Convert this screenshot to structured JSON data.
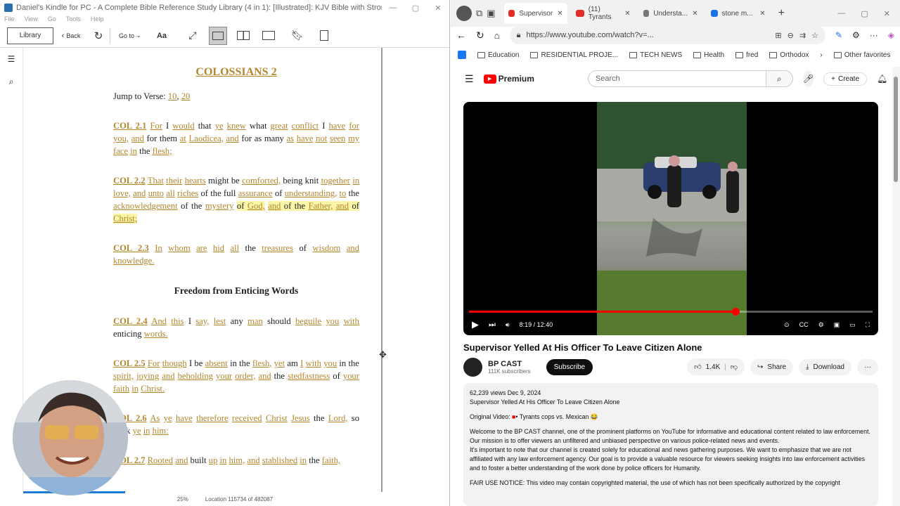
{
  "kindle": {
    "title": "Daniel's Kindle for PC - A Complete Bible Reference Study Library (4 in 1): [Illustrated]: KJV Bible with Strongs markup, Strongs...",
    "menu": [
      "File",
      "View",
      "Go",
      "Tools",
      "Help"
    ],
    "toolbar": {
      "library": "Library",
      "back": "Back",
      "goto": "Go to",
      "font": "Aa"
    },
    "chapter": "COLOSSIANS 2",
    "jump": {
      "label": "Jump to Verse:",
      "v1": "10",
      "v2": "20"
    },
    "verses": {
      "v1": {
        "ref": "COL 2.1",
        "w1": "For",
        "t1": "I",
        "w2": "would",
        "t2": "that",
        "w3": "ye",
        "w4": "knew",
        "t3": "what",
        "w5": "great",
        "w6": "conflict",
        "t4": "I",
        "w7": "have",
        "w8": "for",
        "w9": "you,",
        "w10": "and",
        "t5": "for them",
        "w11": "at",
        "w12": "Laodicea,",
        "w13": "and",
        "t6": "for as many",
        "w14": "as",
        "w15": "have",
        "w16": "not",
        "w17": "seen",
        "w18": "my",
        "w19": "face",
        "w20": "in",
        "t7": "the",
        "w21": "flesh;"
      },
      "v2": {
        "ref": "COL 2.2",
        "w1": "That",
        "w2": "their",
        "w3": "hearts",
        "t1": "might be",
        "w4": "comforted,",
        "t2": "being knit",
        "w5": "together",
        "w6": "in",
        "w7": "love,",
        "w8": "and",
        "w9": "unto",
        "w10": "all",
        "w11": "riches",
        "t3": "of the full",
        "w12": "assurance",
        "t4": "of",
        "w13": "understanding,",
        "w14": "to",
        "t5": "the",
        "w15": "acknowledgement",
        "t6": "of the",
        "w16": "mystery",
        "t7": "of",
        "w17": "God,",
        "w18": "and",
        "t8": "of the",
        "w19": "Father,",
        "w20": "and",
        "t9": "of",
        "w21": "Christ;"
      },
      "v3": {
        "ref": "COL 2.3",
        "w1": "In",
        "w2": "whom",
        "w3": "are",
        "w4": "hid",
        "w5": "all",
        "t1": "the",
        "w6": "treasures",
        "t2": "of",
        "w7": "wisdom",
        "w8": "and",
        "w9": "knowledge."
      },
      "heading": "Freedom from Enticing Words",
      "v4": {
        "ref": "COL 2.4",
        "w1": "And",
        "w2": "this",
        "t1": "I",
        "w3": "say,",
        "w4": "lest",
        "t2": "any",
        "w5": "man",
        "t3": "should",
        "w6": "beguile",
        "w7": "you",
        "w8": "with",
        "t4": "enticing",
        "w9": "words."
      },
      "v5": {
        "ref": "COL 2.5",
        "w1": "For",
        "w2": "though",
        "t1": "I be",
        "w3": "absent",
        "t2": "in the",
        "w4": "flesh,",
        "w5": "yet",
        "t3": "am",
        "w6": "I",
        "w7": "with",
        "w8": "you",
        "t4": "in",
        "t5": "the",
        "w9": "spirit,",
        "w10": "joying",
        "w11": "and",
        "w12": "beholding",
        "w13": "your",
        "w14": "order,",
        "w15": "and",
        "t6": "the",
        "w16": "stedfastness",
        "t7": "of",
        "w17": "your",
        "w18": "faith",
        "w19": "in",
        "w20": "Christ."
      },
      "v6": {
        "ref": "COL 2.6",
        "w1": "As",
        "w2": "ye",
        "w3": "have",
        "w4": "therefore",
        "w5": "received",
        "w6": "Christ",
        "w7": "Jesus",
        "t1": "the",
        "w8": "Lord,",
        "t2": "so",
        "t3": "walk",
        "w9": "ye",
        "w10": "in",
        "w11": "him:"
      },
      "v7": {
        "ref": "COL 2.7",
        "w1": "Rooted",
        "w2": "and",
        "t1": "built",
        "w3": "up",
        "w4": "in",
        "w5": "him,",
        "w6": "and",
        "w7": "stablished",
        "w8": "in",
        "t2": "the",
        "w9": "faith,"
      }
    },
    "status": {
      "percent": "25%",
      "location": "Location 115734 of 482087"
    },
    "progress": 0.25
  },
  "browser": {
    "tabs": [
      {
        "label": "Supervisor",
        "color": "#e52d27"
      },
      {
        "label": "(11) Tyrants",
        "color": "#e52d27"
      },
      {
        "label": "Understa...",
        "color": "#777"
      },
      {
        "label": "stone m...",
        "color": "#1a73e8"
      }
    ],
    "url": "https://www.youtube.com/watch?v=...",
    "favorites": [
      "Education",
      "RESIDENTIAL PROJE...",
      "TECH NEWS",
      "Health",
      "fred",
      "Orthodox"
    ],
    "other_favorites": "Other favorites"
  },
  "youtube": {
    "logo": "Premium",
    "search_placeholder": "Search",
    "create": "Create",
    "time": "8:19 / 12:40",
    "played_fraction": 0.66,
    "video_title": "Supervisor Yelled At His Officer To Leave Citizen Alone",
    "channel": "BP CAST",
    "subscribers": "111K subscribers",
    "subscribe": "Subscribe",
    "likes": "1.4K",
    "share": "Share",
    "download": "Download",
    "views": "62,239 views  Dec 9, 2024",
    "desc_title": "Supervisor Yelled At His Officer To Leave Citizen Alone",
    "original_label": "Original Video:",
    "original_link": "• Tyrants cops vs. Mexican 😂",
    "p1": "Welcome to the BP CAST channel, one of the prominent platforms on YouTube for informative and educational content related to law enforcement. Our mission is to offer viewers an unfiltered and unbiased perspective on various police-related news and events.",
    "p2": "It's important to note that our channel is created solely for educational and news gathering purposes. We want to emphasize that we are not affiliated with any law enforcement agency. Our goal is to provide a valuable resource for viewers seeking insights into law enforcement activities and to foster a better understanding of the work done by police officers for Humanity.",
    "p3": "FAIR USE NOTICE: This video may contain copyrighted material, the use of which has not been specifically authorized by the copyright"
  }
}
